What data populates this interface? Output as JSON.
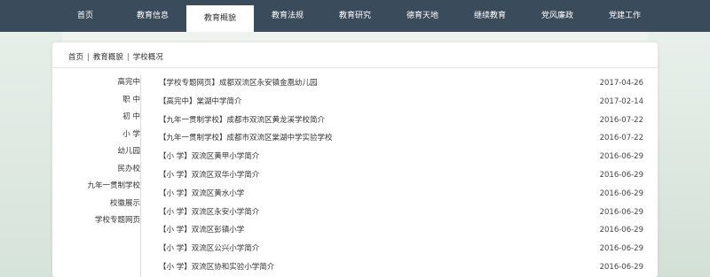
{
  "nav": {
    "items": [
      "首页",
      "教育信息",
      "教育概貌",
      "教育法规",
      "教育研究",
      "德育天地",
      "继续教育",
      "党风廉政",
      "党建工作"
    ],
    "active_index": 2
  },
  "breadcrumb": [
    "首页",
    "教育概貌",
    "学校概况"
  ],
  "sidebar": {
    "items": [
      "高完中",
      "职 中",
      "初 中",
      "小 学",
      "幼儿园",
      "民办校",
      "九年一贯制学校",
      "校徽展示",
      "学校专题网页"
    ]
  },
  "articles": [
    {
      "title": "【学校专题网页】成都双流区永安镇金凰幼儿园",
      "date": "2017-04-26"
    },
    {
      "title": "【高完中】棠湖中学简介",
      "date": "2017-02-14"
    },
    {
      "title": "【九年一贯制学校】成都市双流区黄龙溪学校简介",
      "date": "2016-07-22"
    },
    {
      "title": "【九年一贯制学校】成都市双流区棠湖中学实验学校",
      "date": "2016-07-22"
    },
    {
      "title": "【小 学】双流区黄甲小学简介",
      "date": "2016-06-29"
    },
    {
      "title": "【小 学】双流区双华小学简介",
      "date": "2016-06-29"
    },
    {
      "title": "【小 学】双流区黄水小学",
      "date": "2016-06-29"
    },
    {
      "title": "【小 学】双流区永安小学简介",
      "date": "2016-06-29"
    },
    {
      "title": "【小 学】双流区彭镇小学",
      "date": "2016-06-29"
    },
    {
      "title": "【小 学】双流区公兴小学简介",
      "date": "2016-06-29"
    },
    {
      "title": "【小 学】双流区协和实验小学简介",
      "date": "2016-06-29"
    }
  ]
}
